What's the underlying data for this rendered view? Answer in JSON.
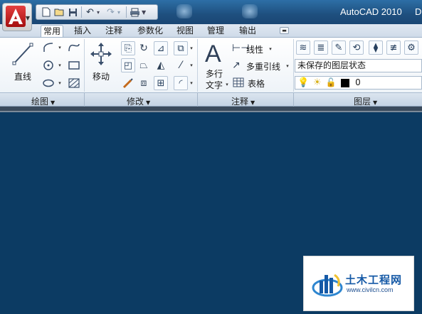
{
  "window": {
    "title": "AutoCAD 2010",
    "title_extra": "D"
  },
  "tabs": [
    "常用",
    "插入",
    "注释",
    "参数化",
    "视图",
    "管理",
    "输出"
  ],
  "ribbon": {
    "draw": {
      "line_label": "直线",
      "panel_title": "绘图"
    },
    "modify": {
      "move_label": "移动",
      "panel_title": "修改"
    },
    "annotation": {
      "mtext_label_1": "多行",
      "mtext_label_2": "文字",
      "linear_label": "线性",
      "mleader_label": "多重引线",
      "table_label": "表格",
      "panel_title": "注释"
    },
    "layers": {
      "layer_state": "未保存的图层状态",
      "current_layer": "0",
      "panel_title": "图层"
    }
  },
  "watermark": {
    "title": "土木工程网",
    "url": "www.civilcn.com"
  },
  "colors": {
    "drawing_background": "#0c3b63",
    "titlebar": "#1e4f7e",
    "accent_red": "#c41a1a",
    "watermark_blue": "#1559a6"
  }
}
